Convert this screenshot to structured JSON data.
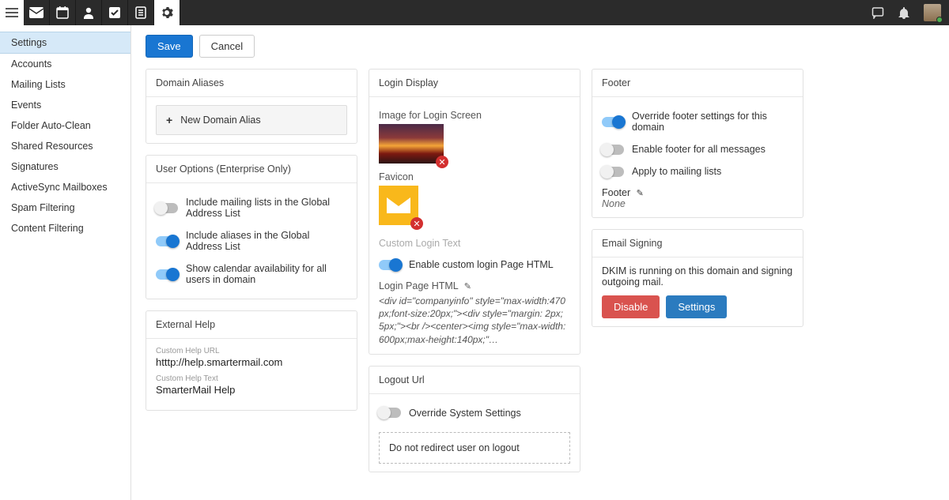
{
  "topbar": {
    "icons": [
      "mail-icon",
      "calendar-icon",
      "person-icon",
      "check-icon",
      "notes-icon",
      "settings-icon"
    ]
  },
  "sidebar": {
    "items": [
      {
        "label": "Settings",
        "active": true
      },
      {
        "label": "Accounts"
      },
      {
        "label": "Mailing Lists"
      },
      {
        "label": "Events"
      },
      {
        "label": "Folder Auto-Clean"
      },
      {
        "label": "Shared Resources"
      },
      {
        "label": "Signatures"
      },
      {
        "label": "ActiveSync Mailboxes"
      },
      {
        "label": "Spam Filtering"
      },
      {
        "label": "Content Filtering"
      }
    ]
  },
  "actions": {
    "save": "Save",
    "cancel": "Cancel"
  },
  "domain_aliases": {
    "title": "Domain Aliases",
    "new_label": "New Domain Alias"
  },
  "user_options": {
    "title": "User Options (Enterprise Only)",
    "opts": [
      {
        "label": "Include mailing lists in the Global Address List",
        "on": false
      },
      {
        "label": "Include aliases in the Global Address List",
        "on": true
      },
      {
        "label": "Show calendar availability for all users in domain",
        "on": true
      }
    ]
  },
  "external_help": {
    "title": "External Help",
    "url_label": "Custom Help URL",
    "url_value": "htttp://help.smartermail.com",
    "text_label": "Custom Help Text",
    "text_value": "SmarterMail Help"
  },
  "login_display": {
    "title": "Login Display",
    "image_label": "Image for Login Screen",
    "favicon_label": "Favicon",
    "custom_login_text_placeholder": "Custom Login Text",
    "enable_custom_html": {
      "label": "Enable custom login Page HTML",
      "on": true
    },
    "page_html_label": "Login Page HTML",
    "page_html_value": "<div id=\"companyinfo\" style=\"max-width:470px;font-size:20px;\"><div style=\"margin: 2px; 5px;\"><br /><center><img style=\"max-width:600px;max-height:140px;\"…"
  },
  "logout_url": {
    "title": "Logout Url",
    "override": {
      "label": "Override System Settings",
      "on": false
    },
    "message": "Do not redirect user on logout"
  },
  "footer": {
    "title": "Footer",
    "opts": [
      {
        "label": "Override footer settings for this domain",
        "on": true
      },
      {
        "label": "Enable footer for all messages",
        "on": false
      },
      {
        "label": "Apply to mailing lists",
        "on": false
      }
    ],
    "footer_label": "Footer",
    "footer_value": "None"
  },
  "email_signing": {
    "title": "Email Signing",
    "status": "DKIM is running on this domain and signing outgoing mail.",
    "disable": "Disable",
    "settings": "Settings"
  }
}
